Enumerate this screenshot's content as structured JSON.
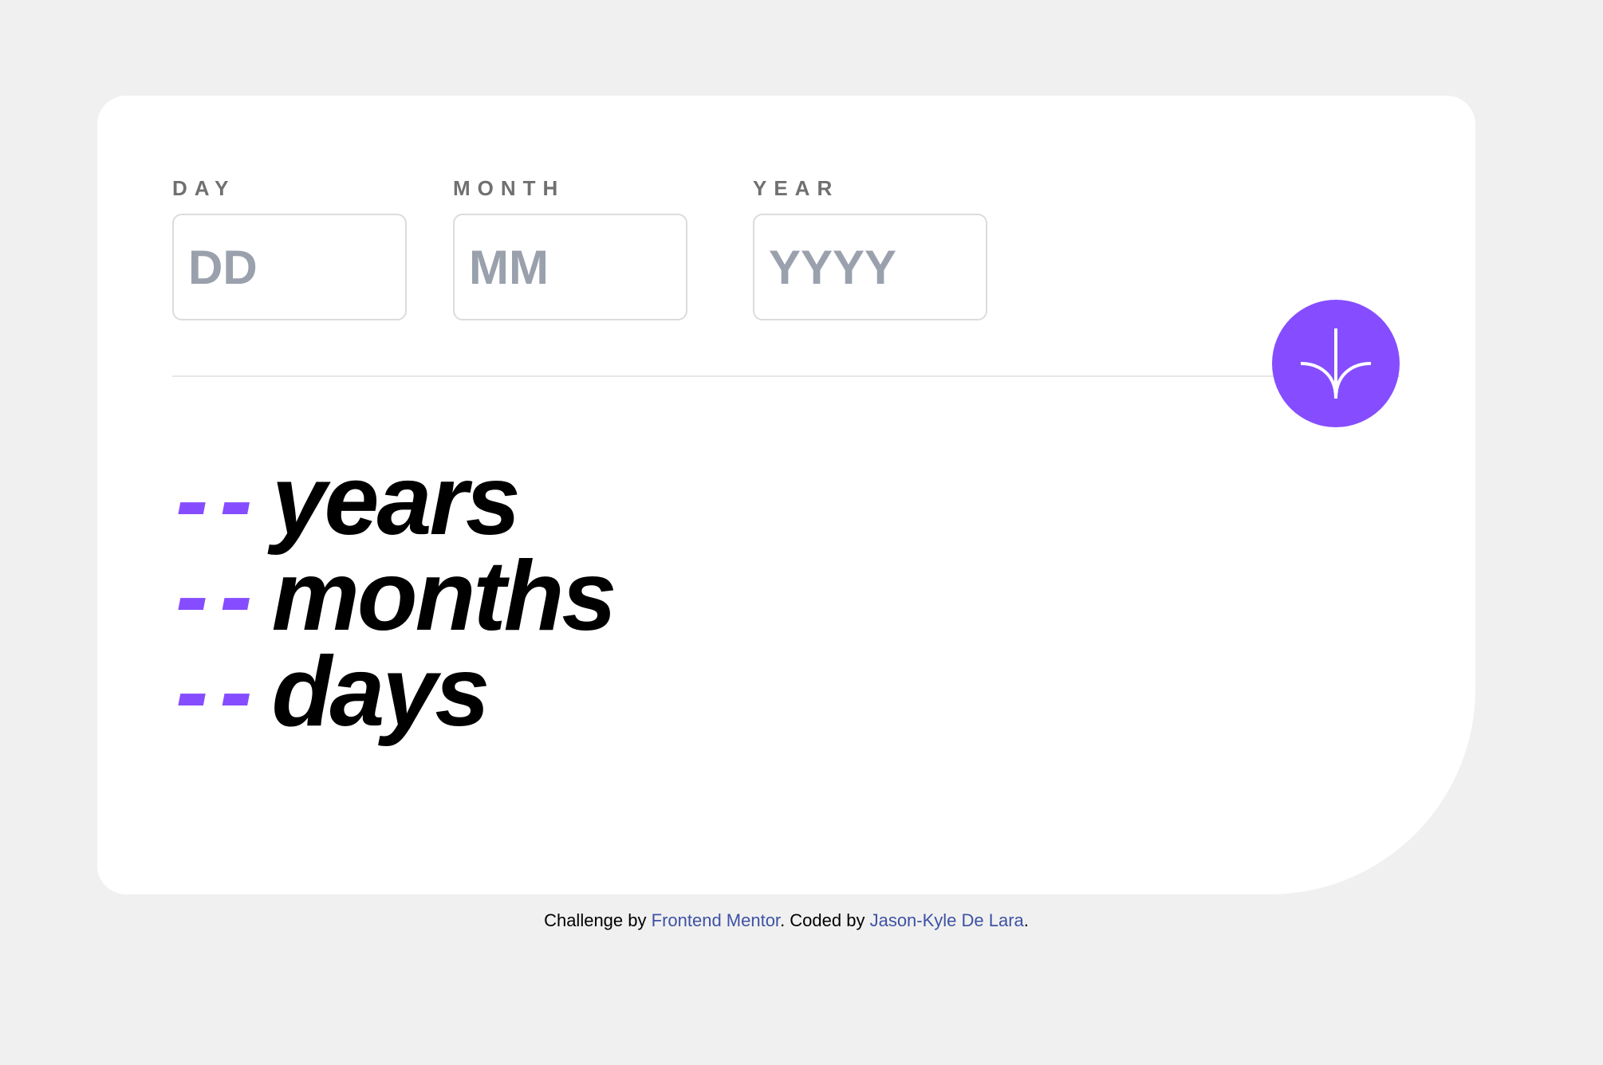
{
  "form": {
    "day": {
      "label": "DAY",
      "placeholder": "DD",
      "value": ""
    },
    "month": {
      "label": "MONTH",
      "placeholder": "MM",
      "value": ""
    },
    "year": {
      "label": "YEAR",
      "placeholder": "YYYY",
      "value": ""
    },
    "submit_icon": "arrow-down-icon"
  },
  "results": [
    {
      "value": "--",
      "unit": "years"
    },
    {
      "value": "--",
      "unit": "months"
    },
    {
      "value": "--",
      "unit": "days"
    }
  ],
  "attribution": {
    "prefix": "Challenge by ",
    "link1": "Frontend Mentor",
    "middle": ". Coded by ",
    "link2": "Jason-Kyle De Lara",
    "suffix": "."
  },
  "colors": {
    "background": "#f0f0f0",
    "card": "#ffffff",
    "accent": "#854dff",
    "label": "#716f6f",
    "placeholder": "#9aa1ad",
    "link": "#3e52a3"
  }
}
